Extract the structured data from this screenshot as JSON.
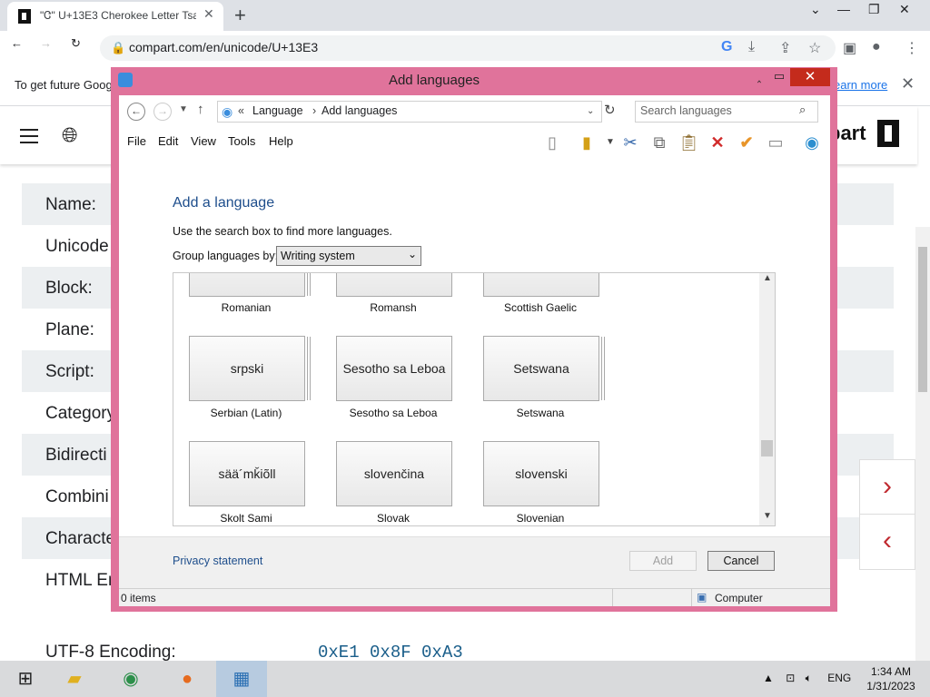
{
  "browser": {
    "tab_title": "\"Ꮳ\" U+13E3 Cherokee Letter Tsa",
    "url": "compart.com/en/unicode/U+13E3",
    "infobar_text": "To get future Goog",
    "infobar_link": "earn more"
  },
  "page": {
    "logo": "part",
    "rows": [
      "Name:",
      "Unicode",
      "Block:",
      "Plane:",
      "Script:",
      "Category",
      "Bidirecti",
      "Combini",
      "Characte",
      "HTML En"
    ],
    "utf8_label": "UTF-8 Encoding:",
    "utf8_value": "0xE1 0x8F 0xA3"
  },
  "dialog": {
    "title": "Add languages",
    "breadcrumb": [
      "Language",
      "Add languages"
    ],
    "search_placeholder": "Search languages",
    "menu": [
      "File",
      "Edit",
      "View",
      "Tools",
      "Help"
    ],
    "heading": "Add a language",
    "hint": "Use the search box to find more languages.",
    "group_label": "Group languages by:",
    "group_value": "Writing system",
    "tiles": [
      {
        "native": "",
        "name": "Romanian"
      },
      {
        "native": "",
        "name": "Romansh"
      },
      {
        "native": "",
        "name": "Scottish Gaelic"
      },
      {
        "native": "srpski",
        "name": "Serbian (Latin)"
      },
      {
        "native": "Sesotho sa Leboa",
        "name": "Sesotho sa Leboa"
      },
      {
        "native": "Setswana",
        "name": "Setswana"
      },
      {
        "native": "sää´mǩiõll",
        "name": "Skolt Sami"
      },
      {
        "native": "slovenčina",
        "name": "Slovak"
      },
      {
        "native": "slovenski",
        "name": "Slovenian"
      }
    ],
    "privacy": "Privacy statement",
    "add": "Add",
    "cancel": "Cancel",
    "status_items": "0 items",
    "status_location": "Computer"
  },
  "taskbar": {
    "lang": "ENG",
    "time": "1:34 AM",
    "date": "1/31/2023"
  }
}
